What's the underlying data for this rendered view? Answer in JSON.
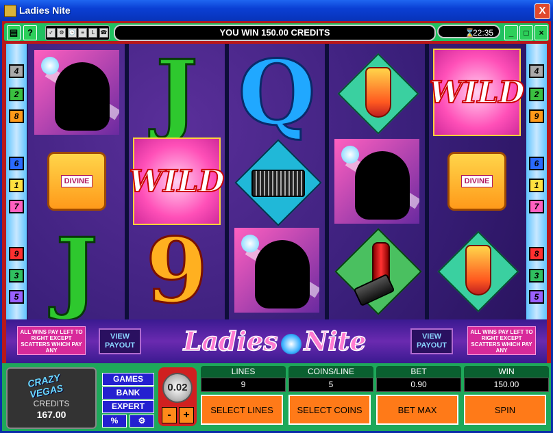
{
  "window": {
    "title": "Ladies Nite",
    "close_label": "X"
  },
  "toolbar": {
    "message": "YOU WIN 150.00 CREDITS",
    "clock": "22:35",
    "help_label": "?",
    "tools": [
      "✓",
      "⚙",
      "🕒",
      "≡",
      "L",
      "☎"
    ]
  },
  "reels": {
    "left_lines": [
      "4",
      "2",
      "8",
      "6",
      "1",
      "7",
      "9",
      "3",
      "5"
    ],
    "right_lines": [
      "4",
      "2",
      "9",
      "6",
      "1",
      "7",
      "8",
      "3",
      "5"
    ],
    "columns": [
      [
        "diva",
        "perfume",
        "J"
      ],
      [
        "J",
        "wild",
        "9"
      ],
      [
        "Q",
        "purse",
        "diva"
      ],
      [
        "cocktail",
        "diva",
        "lipstick"
      ],
      [
        "wild",
        "perfume",
        "cocktail"
      ]
    ],
    "perfume_label": "DIVINE",
    "wild_label": "WILD"
  },
  "banner": {
    "pay_note": "ALL WINS PAY LEFT TO RIGHT EXCEPT SCATTERS WHICH PAY ANY",
    "view_payout": "VIEW PAYOUT",
    "logo_left": "Ladies",
    "logo_right": "Nite"
  },
  "bottom": {
    "brand": "CRAZY VEGAS",
    "credits_label": "CREDITS",
    "credits_value": "167.00",
    "nav": [
      "GAMES",
      "BANK",
      "EXPERT"
    ],
    "percent_label": "%",
    "settings_label": "⚙",
    "coin_value": "0.02",
    "minus": "-",
    "plus": "+",
    "info": [
      {
        "label": "LINES",
        "value": "9"
      },
      {
        "label": "COINS/LINE",
        "value": "5"
      },
      {
        "label": "BET",
        "value": "0.90"
      },
      {
        "label": "WIN",
        "value": "150.00"
      }
    ],
    "actions": [
      "SELECT LINES",
      "SELECT COINS",
      "BET MAX",
      "SPIN"
    ]
  },
  "colors": {
    "frame": "#b8181a",
    "toolbar": "#20c060",
    "accent_orange": "#ff7a18",
    "nav_blue": "#2420d0"
  }
}
